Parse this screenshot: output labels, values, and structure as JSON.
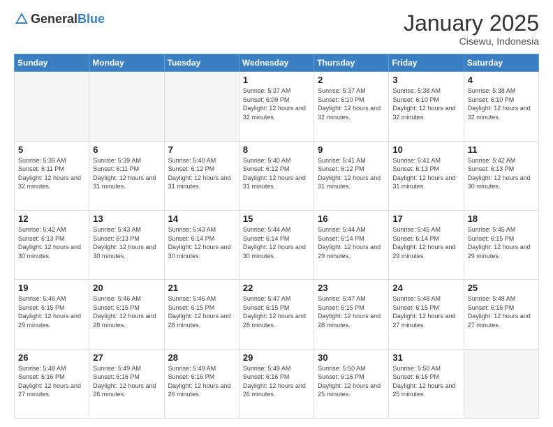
{
  "header": {
    "logo_general": "General",
    "logo_blue": "Blue",
    "month_title": "January 2025",
    "location": "Cisewu, Indonesia"
  },
  "calendar": {
    "days_of_week": [
      "Sunday",
      "Monday",
      "Tuesday",
      "Wednesday",
      "Thursday",
      "Friday",
      "Saturday"
    ],
    "weeks": [
      [
        {
          "day": "",
          "sunrise": "",
          "sunset": "",
          "daylight": "",
          "empty": true
        },
        {
          "day": "",
          "sunrise": "",
          "sunset": "",
          "daylight": "",
          "empty": true
        },
        {
          "day": "",
          "sunrise": "",
          "sunset": "",
          "daylight": "",
          "empty": true
        },
        {
          "day": "1",
          "sunrise": "Sunrise: 5:37 AM",
          "sunset": "Sunset: 6:09 PM",
          "daylight": "Daylight: 12 hours and 32 minutes."
        },
        {
          "day": "2",
          "sunrise": "Sunrise: 5:37 AM",
          "sunset": "Sunset: 6:10 PM",
          "daylight": "Daylight: 12 hours and 32 minutes."
        },
        {
          "day": "3",
          "sunrise": "Sunrise: 5:38 AM",
          "sunset": "Sunset: 6:10 PM",
          "daylight": "Daylight: 12 hours and 32 minutes."
        },
        {
          "day": "4",
          "sunrise": "Sunrise: 5:38 AM",
          "sunset": "Sunset: 6:10 PM",
          "daylight": "Daylight: 12 hours and 32 minutes."
        }
      ],
      [
        {
          "day": "5",
          "sunrise": "Sunrise: 5:39 AM",
          "sunset": "Sunset: 6:11 PM",
          "daylight": "Daylight: 12 hours and 32 minutes."
        },
        {
          "day": "6",
          "sunrise": "Sunrise: 5:39 AM",
          "sunset": "Sunset: 6:11 PM",
          "daylight": "Daylight: 12 hours and 31 minutes."
        },
        {
          "day": "7",
          "sunrise": "Sunrise: 5:40 AM",
          "sunset": "Sunset: 6:12 PM",
          "daylight": "Daylight: 12 hours and 31 minutes."
        },
        {
          "day": "8",
          "sunrise": "Sunrise: 5:40 AM",
          "sunset": "Sunset: 6:12 PM",
          "daylight": "Daylight: 12 hours and 31 minutes."
        },
        {
          "day": "9",
          "sunrise": "Sunrise: 5:41 AM",
          "sunset": "Sunset: 6:12 PM",
          "daylight": "Daylight: 12 hours and 31 minutes."
        },
        {
          "day": "10",
          "sunrise": "Sunrise: 5:41 AM",
          "sunset": "Sunset: 6:13 PM",
          "daylight": "Daylight: 12 hours and 31 minutes."
        },
        {
          "day": "11",
          "sunrise": "Sunrise: 5:42 AM",
          "sunset": "Sunset: 6:13 PM",
          "daylight": "Daylight: 12 hours and 30 minutes."
        }
      ],
      [
        {
          "day": "12",
          "sunrise": "Sunrise: 5:42 AM",
          "sunset": "Sunset: 6:13 PM",
          "daylight": "Daylight: 12 hours and 30 minutes."
        },
        {
          "day": "13",
          "sunrise": "Sunrise: 5:43 AM",
          "sunset": "Sunset: 6:13 PM",
          "daylight": "Daylight: 12 hours and 30 minutes."
        },
        {
          "day": "14",
          "sunrise": "Sunrise: 5:43 AM",
          "sunset": "Sunset: 6:14 PM",
          "daylight": "Daylight: 12 hours and 30 minutes."
        },
        {
          "day": "15",
          "sunrise": "Sunrise: 5:44 AM",
          "sunset": "Sunset: 6:14 PM",
          "daylight": "Daylight: 12 hours and 30 minutes."
        },
        {
          "day": "16",
          "sunrise": "Sunrise: 5:44 AM",
          "sunset": "Sunset: 6:14 PM",
          "daylight": "Daylight: 12 hours and 29 minutes."
        },
        {
          "day": "17",
          "sunrise": "Sunrise: 5:45 AM",
          "sunset": "Sunset: 6:14 PM",
          "daylight": "Daylight: 12 hours and 29 minutes."
        },
        {
          "day": "18",
          "sunrise": "Sunrise: 5:45 AM",
          "sunset": "Sunset: 6:15 PM",
          "daylight": "Daylight: 12 hours and 29 minutes."
        }
      ],
      [
        {
          "day": "19",
          "sunrise": "Sunrise: 5:46 AM",
          "sunset": "Sunset: 6:15 PM",
          "daylight": "Daylight: 12 hours and 29 minutes."
        },
        {
          "day": "20",
          "sunrise": "Sunrise: 5:46 AM",
          "sunset": "Sunset: 6:15 PM",
          "daylight": "Daylight: 12 hours and 28 minutes."
        },
        {
          "day": "21",
          "sunrise": "Sunrise: 5:46 AM",
          "sunset": "Sunset: 6:15 PM",
          "daylight": "Daylight: 12 hours and 28 minutes."
        },
        {
          "day": "22",
          "sunrise": "Sunrise: 5:47 AM",
          "sunset": "Sunset: 6:15 PM",
          "daylight": "Daylight: 12 hours and 28 minutes."
        },
        {
          "day": "23",
          "sunrise": "Sunrise: 5:47 AM",
          "sunset": "Sunset: 6:15 PM",
          "daylight": "Daylight: 12 hours and 28 minutes."
        },
        {
          "day": "24",
          "sunrise": "Sunrise: 5:48 AM",
          "sunset": "Sunset: 6:15 PM",
          "daylight": "Daylight: 12 hours and 27 minutes."
        },
        {
          "day": "25",
          "sunrise": "Sunrise: 5:48 AM",
          "sunset": "Sunset: 6:16 PM",
          "daylight": "Daylight: 12 hours and 27 minutes."
        }
      ],
      [
        {
          "day": "26",
          "sunrise": "Sunrise: 5:48 AM",
          "sunset": "Sunset: 6:16 PM",
          "daylight": "Daylight: 12 hours and 27 minutes."
        },
        {
          "day": "27",
          "sunrise": "Sunrise: 5:49 AM",
          "sunset": "Sunset: 6:16 PM",
          "daylight": "Daylight: 12 hours and 26 minutes."
        },
        {
          "day": "28",
          "sunrise": "Sunrise: 5:49 AM",
          "sunset": "Sunset: 6:16 PM",
          "daylight": "Daylight: 12 hours and 26 minutes."
        },
        {
          "day": "29",
          "sunrise": "Sunrise: 5:49 AM",
          "sunset": "Sunset: 6:16 PM",
          "daylight": "Daylight: 12 hours and 26 minutes."
        },
        {
          "day": "30",
          "sunrise": "Sunrise: 5:50 AM",
          "sunset": "Sunset: 6:16 PM",
          "daylight": "Daylight: 12 hours and 25 minutes."
        },
        {
          "day": "31",
          "sunrise": "Sunrise: 5:50 AM",
          "sunset": "Sunset: 6:16 PM",
          "daylight": "Daylight: 12 hours and 25 minutes."
        },
        {
          "day": "",
          "sunrise": "",
          "sunset": "",
          "daylight": "",
          "empty": true
        }
      ]
    ]
  }
}
